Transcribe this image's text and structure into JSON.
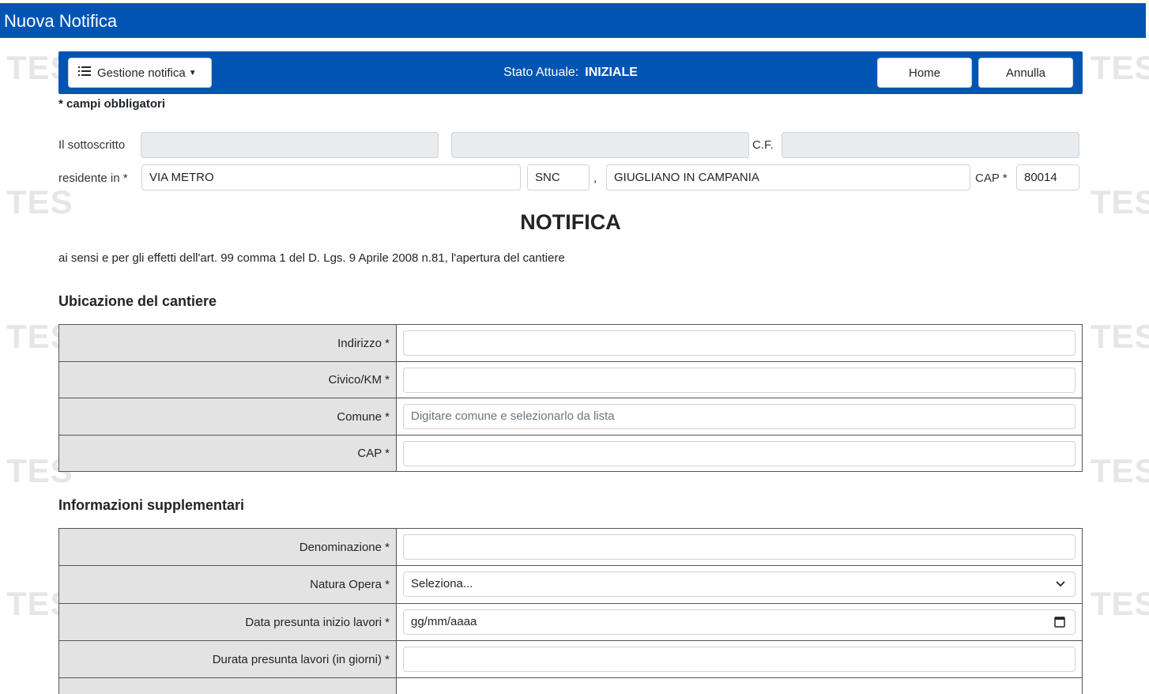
{
  "header": {
    "title": "Nuova Notifica"
  },
  "watermark": "TES",
  "toolbar": {
    "menu_label": "Gestione notifica",
    "state_label": "Stato Attuale:",
    "state_value": "INIZIALE",
    "home_label": "Home",
    "cancel_label": "Annulla"
  },
  "required_note": "* campi obbligatori",
  "declarant": {
    "label_undersigned": "Il sottoscritto",
    "label_cf": "C.F.",
    "label_resident": "residente in *",
    "street": "VIA METRO",
    "number": "SNC",
    "comma": ",",
    "city": "GIUGLIANO IN CAMPANIA",
    "label_cap": "CAP *",
    "cap": "80014"
  },
  "title": "NOTIFICA",
  "subtitle": "ai sensi e per gli effetti dell'art. 99 comma 1 del D. Lgs. 9 Aprile 2008 n.81, l'apertura del cantiere",
  "site_section": {
    "title": "Ubicazione del cantiere",
    "rows": [
      {
        "label": "Indirizzo *",
        "value": ""
      },
      {
        "label": "Civico/KM *",
        "value": ""
      },
      {
        "label": "Comune *",
        "placeholder": "Digitare comune e selezionarlo da lista"
      },
      {
        "label": "CAP *",
        "value": ""
      }
    ]
  },
  "extra_section": {
    "title": "Informazioni supplementari",
    "rows": [
      {
        "label": "Denominazione *",
        "value": ""
      },
      {
        "label": "Natura Opera *",
        "value": "Seleziona..."
      },
      {
        "label": "Data presunta inizio lavori *",
        "value": "gg/mm/aaaa"
      },
      {
        "label": "Durata presunta lavori (in giorni) *",
        "value": ""
      }
    ]
  },
  "icons": {
    "menu": "list-icon",
    "caret": "caret-down-icon",
    "select": "chevron-down-icon",
    "date": "calendar-icon"
  },
  "colors": {
    "primary": "#0055b3",
    "label_bg": "#e3e3e3"
  }
}
